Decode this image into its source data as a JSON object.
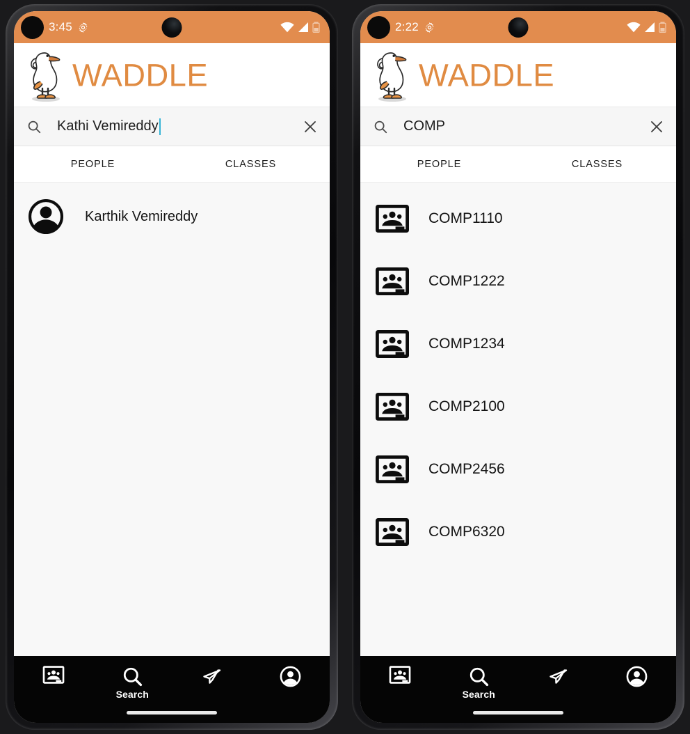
{
  "app": {
    "name": "WADDLE",
    "brand_color": "#e28c4e",
    "logo_icon": "duck-mascot-icon"
  },
  "phones": [
    {
      "id": "phone-left",
      "status_bar": {
        "time": "3:45",
        "icons": [
          "settings-gear-icon",
          "wifi-icon",
          "cellular-signal-icon",
          "battery-icon"
        ]
      },
      "search": {
        "value": "Kathi Vemireddy",
        "placeholder": "Search",
        "caret_visible": true,
        "caret_color": "#35b3d6",
        "search_icon": "search-icon",
        "clear_icon": "close-icon"
      },
      "tabs": [
        {
          "label": "PEOPLE",
          "active": true
        },
        {
          "label": "CLASSES",
          "active": false
        }
      ],
      "results": {
        "kind": "people",
        "items": [
          {
            "label": "Karthik Vemireddy",
            "icon": "account-circle-icon"
          }
        ]
      }
    },
    {
      "id": "phone-right",
      "status_bar": {
        "time": "2:22",
        "icons": [
          "settings-gear-icon",
          "wifi-icon",
          "cellular-signal-icon",
          "battery-icon"
        ]
      },
      "search": {
        "value": "COMP",
        "placeholder": "Search",
        "caret_visible": false,
        "caret_color": "#35b3d6",
        "search_icon": "search-icon",
        "clear_icon": "close-icon"
      },
      "tabs": [
        {
          "label": "PEOPLE",
          "active": false
        },
        {
          "label": "CLASSES",
          "active": true
        }
      ],
      "results": {
        "kind": "classes",
        "items": [
          {
            "label": "COMP1110",
            "icon": "groups-classroom-icon"
          },
          {
            "label": "COMP1222",
            "icon": "groups-classroom-icon"
          },
          {
            "label": "COMP1234",
            "icon": "groups-classroom-icon"
          },
          {
            "label": "COMP2100",
            "icon": "groups-classroom-icon"
          },
          {
            "label": "COMP2456",
            "icon": "groups-classroom-icon"
          },
          {
            "label": "COMP6320",
            "icon": "groups-classroom-icon"
          }
        ]
      }
    }
  ],
  "bottom_nav": {
    "items": [
      {
        "label": "",
        "icon": "classroom-icon",
        "active": false
      },
      {
        "label": "Search",
        "icon": "search-icon",
        "active": true
      },
      {
        "label": "",
        "icon": "send-paper-plane-icon",
        "active": false
      },
      {
        "label": "",
        "icon": "account-circle-icon",
        "active": false
      }
    ]
  }
}
